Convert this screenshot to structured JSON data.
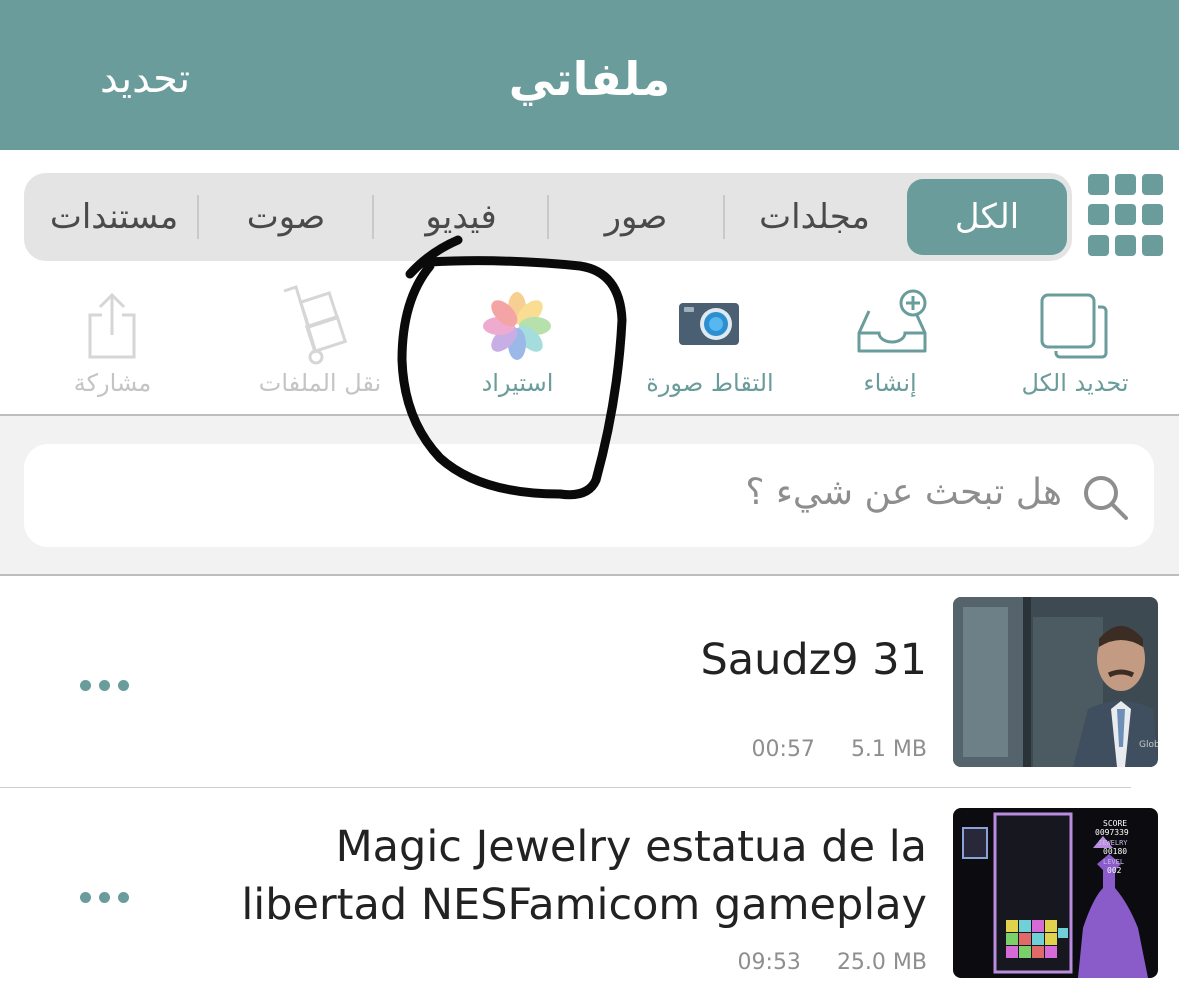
{
  "header": {
    "title": "ملفاتي",
    "edit_label": "تحديد"
  },
  "segments": {
    "items": [
      "الكل",
      "مجلدات",
      "صور",
      "فيديو",
      "صوت",
      "مستندات"
    ],
    "selected": "الكل"
  },
  "toolbar": {
    "select_all": "تحديد الكل",
    "create": "إنشاء",
    "take_photo": "التقاط صورة",
    "import": "استيراد",
    "move_files": "نقل الملفات",
    "share": "مشاركة"
  },
  "search": {
    "placeholder": "هل تبحث عن شيء ؟"
  },
  "files": [
    {
      "title": "Saudz9 31",
      "duration": "00:57",
      "size": "5.1 MB"
    },
    {
      "title": "Magic Jewelry estatua de la libertad NESFamicom gameplay",
      "duration": "09:53",
      "size": "25.0 MB"
    }
  ],
  "thumbnail_text": {
    "watermark": "Glob",
    "score_label": "SCORE",
    "score_value": "0097339",
    "jewelry_label": "JEWELRY",
    "jewelry_value": "00180",
    "level_label": "LEVEL",
    "level_value": "002"
  },
  "colors": {
    "accent": "#6a9c9b",
    "disabled": "#c4c4c4"
  }
}
